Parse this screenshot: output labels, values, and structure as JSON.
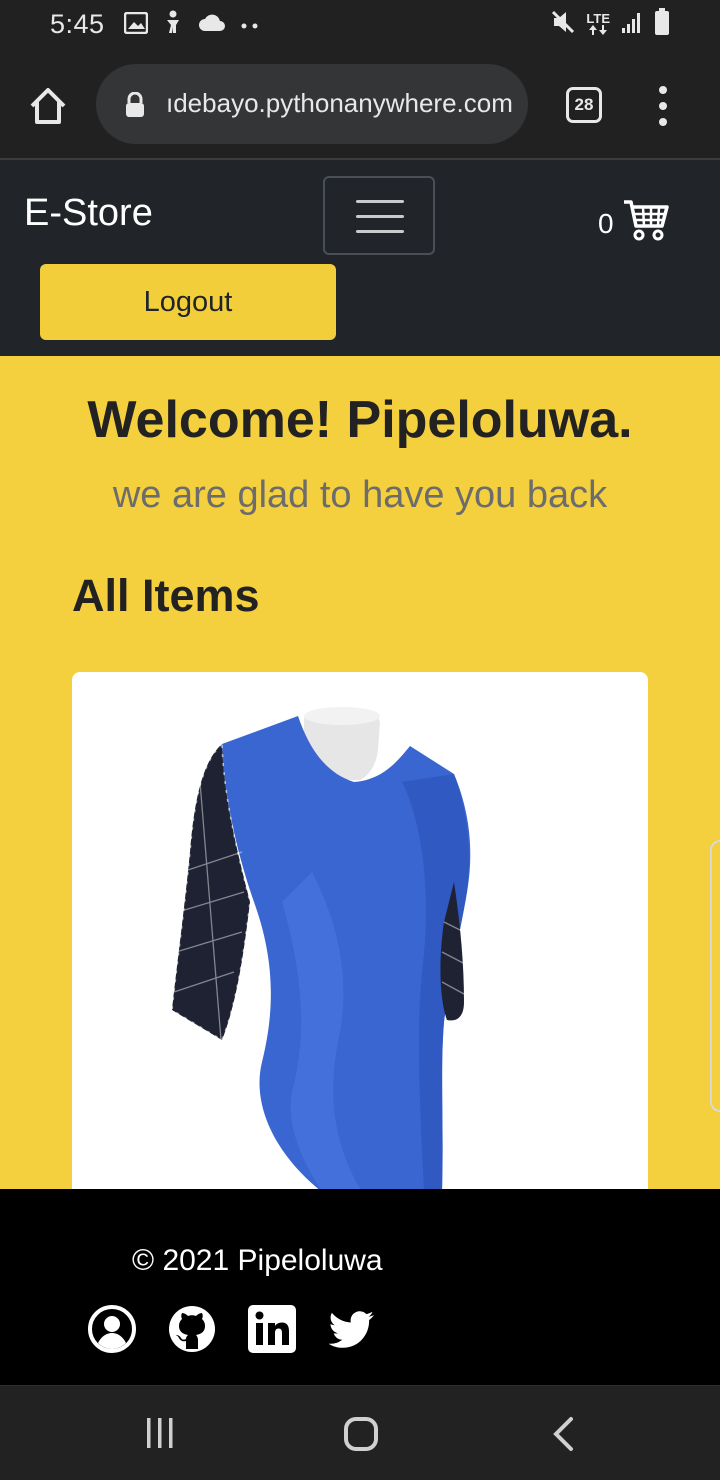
{
  "status_bar": {
    "time": "5:45",
    "network": "LTE"
  },
  "browser": {
    "url": "ıdebayo.pythonanywhere.com",
    "tab_count": "28"
  },
  "navbar": {
    "brand": "E-Store",
    "cart_count": "0",
    "logout_label": "Logout"
  },
  "main": {
    "welcome": "Welcome! Pipeloluwa.",
    "subtitle": "we are glad to have you back",
    "section_title": "All Items"
  },
  "footer": {
    "copyright": "© 2021 Pipeloluwa",
    "social_icons": [
      "user-circle-icon",
      "github-icon",
      "linkedin-icon",
      "twitter-icon"
    ]
  },
  "colors": {
    "accent": "#f4cf3e",
    "dark": "#212529",
    "footer": "#000000",
    "dress": "#3a66d1"
  }
}
